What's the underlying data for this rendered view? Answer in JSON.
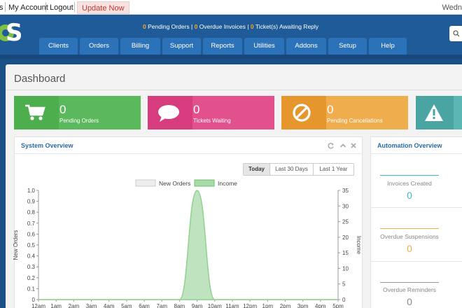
{
  "topbar": {
    "links": [
      "s",
      "My Account",
      "Logout"
    ],
    "update_label": "Update Now",
    "date_partial": "Wedn"
  },
  "header": {
    "logo_text": "S",
    "notice": {
      "pending_orders_count": "0",
      "pending_orders_label": "Pending Orders",
      "overdue_count": "0",
      "overdue_label": "Overdue Invoices",
      "tickets_count": "0",
      "tickets_label": "Ticket(s) Awaiting Reply",
      "separator": "|"
    },
    "nav": [
      "Clients",
      "Orders",
      "Billing",
      "Support",
      "Reports",
      "Utilities",
      "Addons",
      "Setup",
      "Help"
    ]
  },
  "dashboard": {
    "title": "Dashboard",
    "cards": [
      {
        "value": "0",
        "label": "Pending Orders",
        "color": "#5cb85c",
        "icon": "cart-icon"
      },
      {
        "value": "0",
        "label": "Tickets Waiting",
        "color": "#e2508e",
        "icon": "chat-icon"
      },
      {
        "value": "0",
        "label": "Pending Cancellations",
        "color": "#f0ad4e",
        "icon": "ban-icon"
      },
      {
        "value": "",
        "label": "",
        "color": "#5bb7b4",
        "icon": "warning-icon"
      }
    ]
  },
  "system_overview": {
    "title": "System Overview",
    "buttons": [
      "Today",
      "Last 30 Days",
      "Last 1 Year"
    ],
    "active_button": "Today"
  },
  "automation": {
    "title": "Automation Overview",
    "items": [
      {
        "label": "Invoices Created",
        "value": "0",
        "color": "#3fb8c6"
      },
      {
        "label": "Overdue Suspensions",
        "value": "0",
        "color": "#f0ad4e"
      },
      {
        "label": "Overdue Reminders",
        "value": "0",
        "color": "#999999"
      }
    ]
  },
  "chart_data": {
    "type": "area",
    "series": [
      {
        "name": "New Orders",
        "axis": "left",
        "color": "#dddddd",
        "values": [
          0,
          0,
          0,
          0,
          0,
          0,
          0,
          0,
          0,
          0,
          0,
          0,
          0,
          0,
          0,
          0,
          0,
          0
        ]
      },
      {
        "name": "Income",
        "axis": "right",
        "color": "#8fd18f",
        "values": [
          0,
          0,
          0,
          0,
          0,
          0,
          0,
          0,
          0,
          35,
          0,
          0,
          0,
          0,
          0,
          0,
          0,
          0
        ]
      }
    ],
    "x": [
      "12am",
      "1am",
      "2am",
      "3am",
      "4am",
      "5am",
      "6am",
      "7am",
      "8am",
      "9am",
      "10am",
      "11am",
      "12pm",
      "1pm",
      "2pm",
      "3pm",
      "4pm",
      "5pm"
    ],
    "ylabel": "New Orders",
    "y2label": "Income",
    "ylim": [
      0,
      1.0
    ],
    "y2lim": [
      0,
      35
    ],
    "yticks": [
      "1.0",
      "0.9",
      "0.8",
      "0.7",
      "0.6",
      "0.5",
      "0.4",
      "0.3",
      "0.2",
      "0.1",
      "0"
    ],
    "y2ticks": [
      "35",
      "30",
      "25",
      "20",
      "15",
      "10",
      "5",
      "0"
    ],
    "legend": "top-center"
  }
}
